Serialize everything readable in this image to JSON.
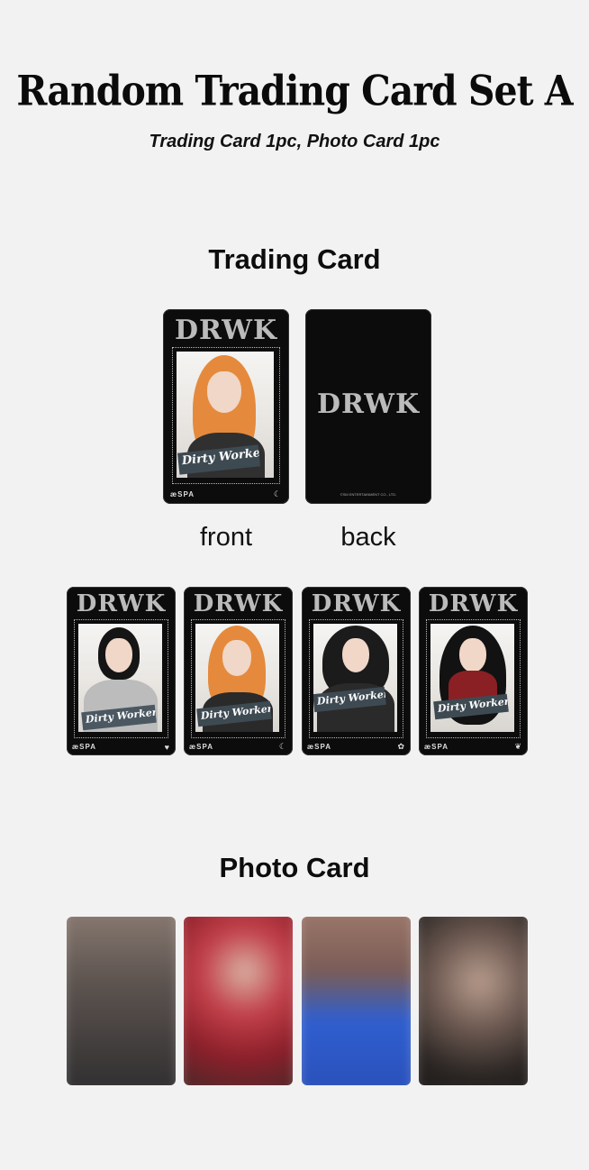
{
  "header": {
    "title": "Random Trading Card Set A",
    "subtitle": "Trading Card 1pc, Photo Card 1pc"
  },
  "trading_section": {
    "title": "Trading Card",
    "front_label": "front",
    "back_label": "back",
    "card_logo": "DRWK",
    "card_brand": "æSPA",
    "sign_text": "Dirty Worker",
    "copyright": "©SM ENTERTAINMENT CO., LTD."
  },
  "photo_section": {
    "title": "Photo Card"
  },
  "colors": {
    "background": "#f2f2f2",
    "card": "#0c0c0c",
    "photo_1": "#4a4542",
    "photo_2": "#b0343c",
    "photo_3": "#2f5fd0",
    "photo_4": "#2a2523"
  },
  "icons": [
    "crescent-icon",
    "heart-icon",
    "flower-icon",
    "butterfly-icon"
  ]
}
